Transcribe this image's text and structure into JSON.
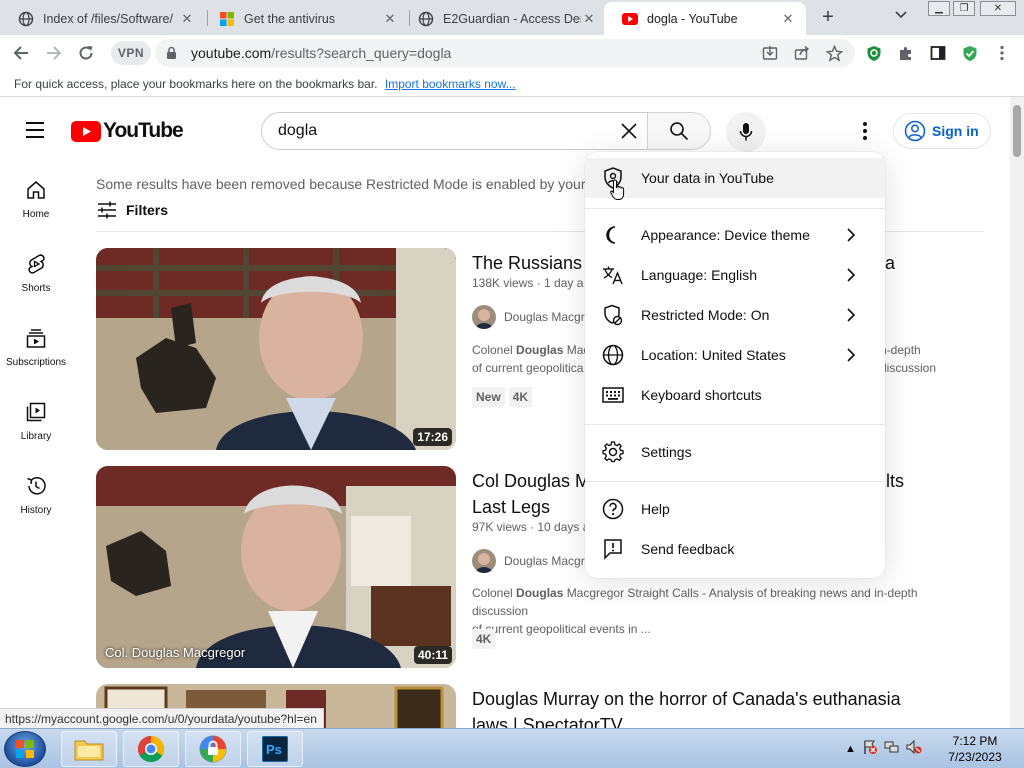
{
  "browser": {
    "tabs": [
      {
        "title": "Index of /files/Software/",
        "active": false
      },
      {
        "title": "Get the antivirus",
        "active": false
      },
      {
        "title": "E2Guardian - Access Deni",
        "active": false
      },
      {
        "title": "dogla - YouTube",
        "active": true
      }
    ],
    "vpn_label": "VPN",
    "url_host": "youtube.com",
    "url_path": "/results?search_query=dogla",
    "bookmarks_hint": "For quick access, place your bookmarks here on the bookmarks bar.",
    "bookmarks_link": "Import bookmarks now..."
  },
  "youtube": {
    "logo_text": "YouTube",
    "search_value": "dogla",
    "sign_in": "Sign in",
    "guide": [
      "Home",
      "Shorts",
      "Subscriptions",
      "Library",
      "History"
    ],
    "notice": "Some results have been removed because Restricted Mode is enabled by your n",
    "filters_label": "Filters",
    "results": [
      {
        "title": "The Russians",
        "title_tail": "sa",
        "meta": "138K views · 1 day a",
        "channel": "Douglas Macgr",
        "desc_prefix": "Colonel ",
        "desc_bold": "Douglas",
        "desc_rest": " Mac",
        "desc_tail": "n-depth discussion",
        "desc_line2": "of current geopolitica",
        "badges": [
          "New",
          "4K"
        ],
        "duration": "17:26"
      },
      {
        "title": "Col Douglas M",
        "title_tail": "lts",
        "title_line2": "Last Legs",
        "meta": "97K views · 10 days a",
        "channel": "Douglas Macgr",
        "desc_prefix": "Colonel ",
        "desc_bold": "Douglas",
        "desc_rest": " Macgregor Straight Calls - Analysis of breaking news and in-depth discussion",
        "desc_line2": "of current geopolitical events in ...",
        "badges": [
          "4K"
        ],
        "duration": "40:11",
        "thumb_caption": "Col. Douglas Macgregor"
      },
      {
        "title": "Douglas Murray on the horror of Canada's euthanasia",
        "title_line2": "laws | SpectatorTV"
      }
    ]
  },
  "menu": {
    "items": [
      {
        "label": "Your data in YouTube",
        "icon": "shield-person-icon"
      },
      {
        "label": "Appearance: Device theme",
        "icon": "moon-icon",
        "submenu": true
      },
      {
        "label": "Language: English",
        "icon": "translate-icon",
        "submenu": true
      },
      {
        "label": "Restricted Mode: On",
        "icon": "restricted-shield-icon",
        "submenu": true
      },
      {
        "label": "Location: United States",
        "icon": "globe-icon",
        "submenu": true
      },
      {
        "label": "Keyboard shortcuts",
        "icon": "keyboard-icon"
      },
      {
        "label": "Settings",
        "icon": "gear-icon"
      },
      {
        "label": "Help",
        "icon": "help-icon"
      },
      {
        "label": "Send feedback",
        "icon": "feedback-icon"
      }
    ]
  },
  "status_url": "https://myaccount.google.com/u/0/yourdata/youtube?hl=en",
  "taskbar": {
    "time": "7:12 PM",
    "date": "7/23/2023"
  }
}
